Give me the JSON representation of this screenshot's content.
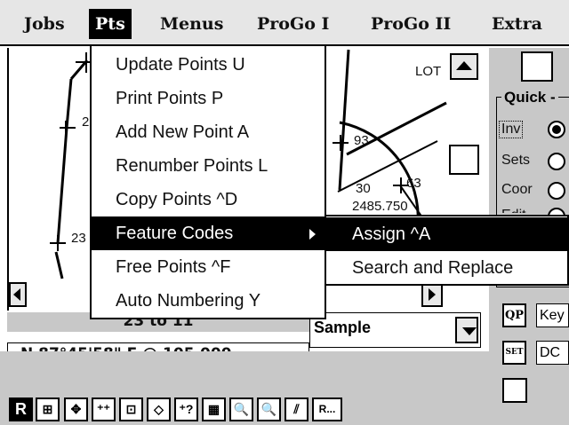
{
  "menubar": {
    "items": [
      {
        "label": "Jobs"
      },
      {
        "label": "Pts"
      },
      {
        "label": "Menus"
      },
      {
        "label": "ProGo I"
      },
      {
        "label": "ProGo II"
      },
      {
        "label": "Extra"
      }
    ],
    "active_index": 1
  },
  "pts_menu": {
    "items": [
      {
        "label": "Update Points U"
      },
      {
        "label": "Print Points P"
      },
      {
        "label": "Add New Point A"
      },
      {
        "label": "Renumber Points L"
      },
      {
        "label": "Copy Points ^D"
      },
      {
        "label": "Feature Codes",
        "has_submenu": true,
        "highlighted": true
      },
      {
        "label": "Free Points ^F"
      },
      {
        "label": "Auto Numbering Y"
      }
    ]
  },
  "feature_codes_submenu": {
    "items": [
      {
        "label": "Assign ^A",
        "highlighted": true
      },
      {
        "label": "Search and Replace"
      }
    ]
  },
  "canvas": {
    "labels": {
      "pt_lot": "LOT",
      "pt_23": "23",
      "pt_2": "2",
      "pt_93": "93",
      "pt_30": "30",
      "pt_63": "63",
      "elev": "2485.750"
    }
  },
  "status": {
    "range": "23 to 11",
    "bearing": "N 87°45'58\" E @ 105.000",
    "dropdown_value": "Sample"
  },
  "quick_panel": {
    "title": "Quick -",
    "options": [
      {
        "label": "Inv",
        "selected": true
      },
      {
        "label": "Sets",
        "selected": false
      },
      {
        "label": "Coor",
        "selected": false
      },
      {
        "label": "Edit",
        "selected": false
      }
    ],
    "qp_label": "QP",
    "key_field": "Key",
    "set_label": "SET",
    "dc_field": "DC"
  },
  "toolbar": {
    "buttons": [
      {
        "name": "r-button",
        "text": "R"
      },
      {
        "name": "grid-view-button",
        "text": "⊞"
      },
      {
        "name": "pan-button",
        "text": "✥"
      },
      {
        "name": "add-points-button",
        "text": "⁺⁺"
      },
      {
        "name": "zoom-window-button",
        "text": "⊡"
      },
      {
        "name": "zoom-extents-button",
        "text": "◇"
      },
      {
        "name": "query-point-button",
        "text": "⁺?"
      },
      {
        "name": "tile-view-button",
        "text": "▦"
      },
      {
        "name": "zoom-in-button",
        "text": "🔍"
      },
      {
        "name": "zoom-out-button",
        "text": "🔍"
      },
      {
        "name": "line-tool-button",
        "text": "⫽"
      },
      {
        "name": "r-more-button",
        "text": "R..."
      }
    ]
  }
}
